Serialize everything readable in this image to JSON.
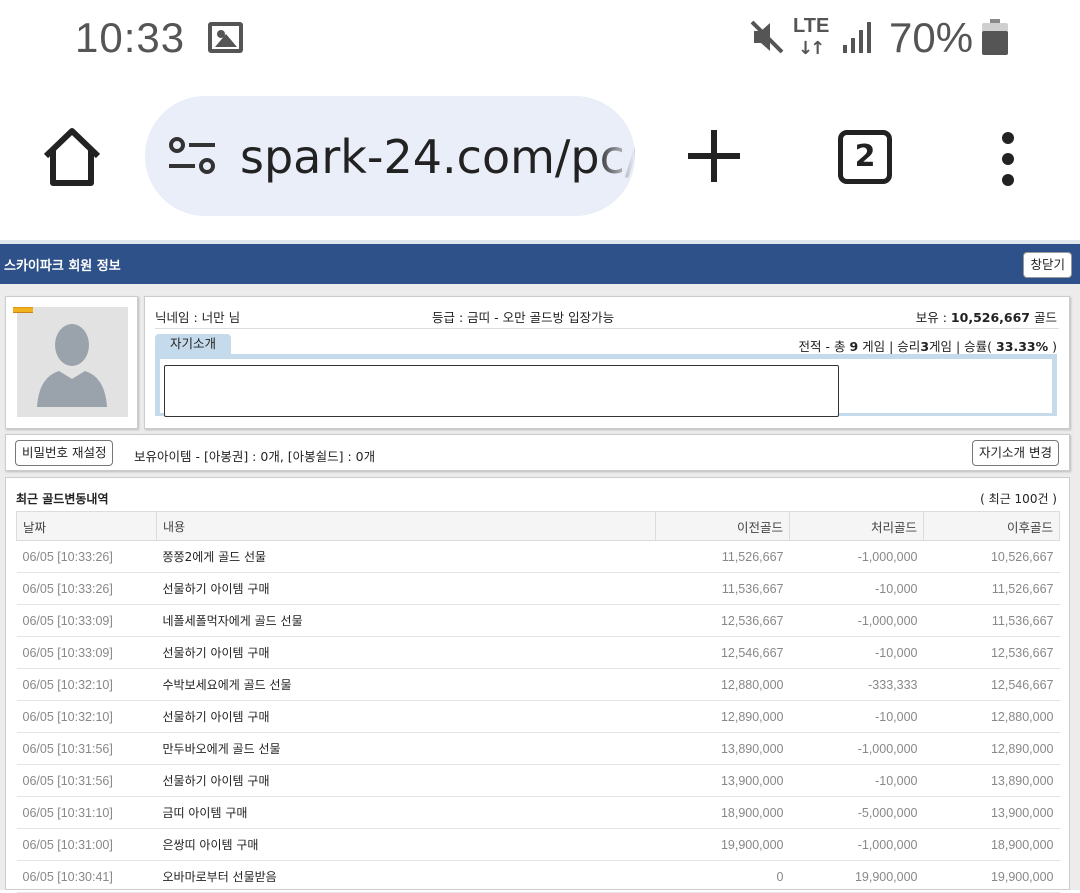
{
  "status_bar": {
    "time": "10:33",
    "network": "LTE",
    "battery_pct": "70%"
  },
  "browser": {
    "url": "spark-24.com/pc/",
    "tab_count": "2"
  },
  "page": {
    "title": "스카이파크 회원 정보",
    "close_label": "창닫기"
  },
  "profile": {
    "nickname_label": "닉네임 :",
    "nickname": "너만 님",
    "grade_label": "등급 :",
    "grade_value": "금띠 - 오만 골드방 입장가능",
    "gold_label": "보유 :",
    "gold_amount": "10,526,667",
    "gold_unit": "골드",
    "intro_tab": "자기소개",
    "record_prefix": "전적 - 총",
    "total_games": "9",
    "record_mid": "게임 | 승리",
    "wins": "3",
    "record_rate_label": "게임 | 승률(",
    "win_rate": "33.33%",
    "record_suffix": ")",
    "intro_text": ""
  },
  "items_bar": {
    "reset_password_label": "비밀번호 재설정",
    "items_text": "보유아이템 - [아봉권] : 0개, [아봉쉴드] : 0개",
    "change_intro_label": "자기소개 변경"
  },
  "history": {
    "title": "최근 골드변동내역",
    "count_label": "( 최근 100건 )",
    "columns": [
      "날짜",
      "내용",
      "이전골드",
      "처리골드",
      "이후골드"
    ],
    "rows": [
      {
        "date": "06/05 [10:33:26]",
        "desc": "쫑쫑2에게 골드 선물",
        "before": "11,526,667",
        "change": "-1,000,000",
        "after": "10,526,667"
      },
      {
        "date": "06/05 [10:33:26]",
        "desc": "선물하기 아이템 구매",
        "before": "11,536,667",
        "change": "-10,000",
        "after": "11,526,667"
      },
      {
        "date": "06/05 [10:33:09]",
        "desc": "네폴세폴먹자에게 골드 선물",
        "before": "12,536,667",
        "change": "-1,000,000",
        "after": "11,536,667"
      },
      {
        "date": "06/05 [10:33:09]",
        "desc": "선물하기 아이템 구매",
        "before": "12,546,667",
        "change": "-10,000",
        "after": "12,536,667"
      },
      {
        "date": "06/05 [10:32:10]",
        "desc": "수박보세요에게 골드 선물",
        "before": "12,880,000",
        "change": "-333,333",
        "after": "12,546,667"
      },
      {
        "date": "06/05 [10:32:10]",
        "desc": "선물하기 아이템 구매",
        "before": "12,890,000",
        "change": "-10,000",
        "after": "12,880,000"
      },
      {
        "date": "06/05 [10:31:56]",
        "desc": "만두바오에게 골드 선물",
        "before": "13,890,000",
        "change": "-1,000,000",
        "after": "12,890,000"
      },
      {
        "date": "06/05 [10:31:56]",
        "desc": "선물하기 아이템 구매",
        "before": "13,900,000",
        "change": "-10,000",
        "after": "13,890,000"
      },
      {
        "date": "06/05 [10:31:10]",
        "desc": "금띠 아이템 구매",
        "before": "18,900,000",
        "change": "-5,000,000",
        "after": "13,900,000"
      },
      {
        "date": "06/05 [10:31:00]",
        "desc": "은쌍띠 아이템 구매",
        "before": "19,900,000",
        "change": "-1,000,000",
        "after": "18,900,000"
      },
      {
        "date": "06/05 [10:30:41]",
        "desc": "오바마로부터 선물받음",
        "before": "0",
        "change": "19,900,000",
        "after": "19,900,000"
      }
    ]
  },
  "icons": {
    "status_image": "image-icon",
    "mute": "mute-icon",
    "signal": "signal-icon",
    "battery": "battery-icon",
    "home": "home-icon",
    "site_settings": "tune-icon",
    "new_tab": "plus-icon",
    "tabs": "tab-switcher-icon",
    "menu": "more-vert-icon"
  },
  "colors": {
    "header_bg": "#2d5188",
    "url_bar_bg": "#e9eef8",
    "intro_tab_bg": "#c5dbeb",
    "rank_badge": "#f2b21b"
  }
}
